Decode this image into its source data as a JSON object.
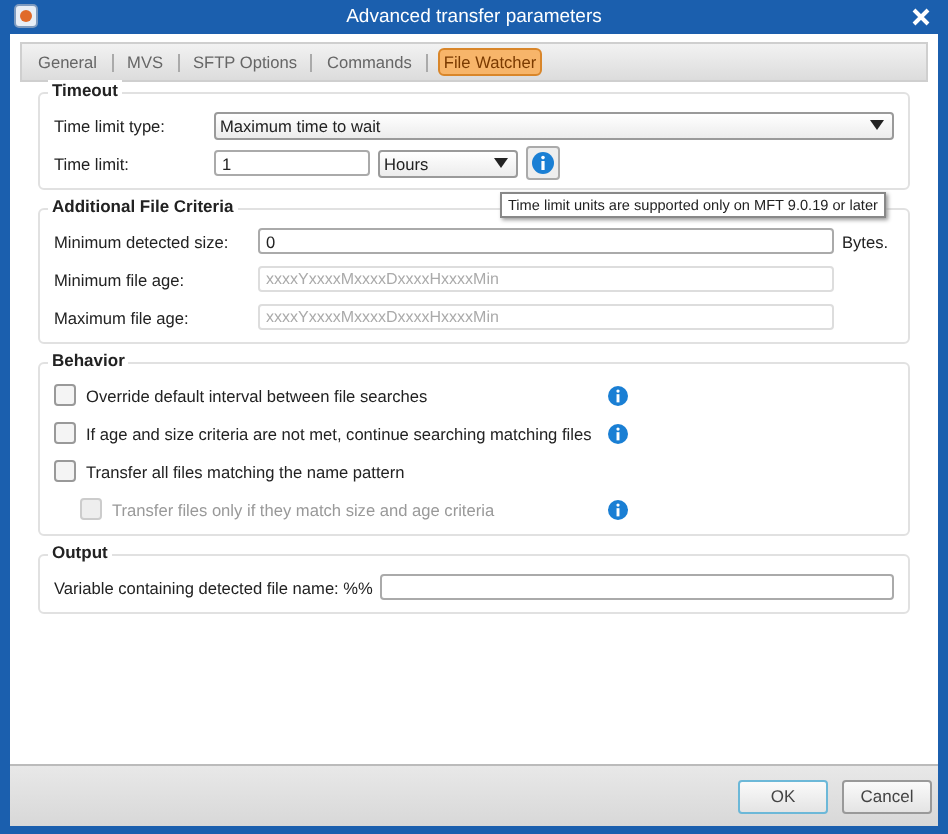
{
  "window": {
    "title": "Advanced transfer parameters"
  },
  "tabs": [
    {
      "label": "General",
      "selected": false
    },
    {
      "label": "MVS",
      "selected": false
    },
    {
      "label": "SFTP Options",
      "selected": false
    },
    {
      "label": "Commands",
      "selected": false
    },
    {
      "label": "File Watcher",
      "selected": true
    }
  ],
  "timeout": {
    "title": "Timeout",
    "type_label": "Time limit type:",
    "type_value": "Maximum time to wait",
    "limit_label": "Time limit:",
    "limit_value": "1",
    "unit_value": "Hours"
  },
  "tooltip": "Time limit units are supported only on MFT 9.0.19 or later",
  "criteria": {
    "title": "Additional File Criteria",
    "min_size_label": "Minimum detected size:",
    "min_size_value": "0",
    "min_size_unit": "Bytes.",
    "min_age_label": "Minimum file age:",
    "min_age_placeholder": "xxxxYxxxxMxxxxDxxxxHxxxxMin",
    "max_age_label": "Maximum file age:",
    "max_age_placeholder": "xxxxYxxxxMxxxxDxxxxHxxxxMin"
  },
  "behavior": {
    "title": "Behavior",
    "options": [
      {
        "label": "Override default interval between file searches",
        "checked": false,
        "disabled": false,
        "info": true
      },
      {
        "label": "If age and size criteria are not met, continue searching matching files",
        "checked": false,
        "disabled": false,
        "info": true
      },
      {
        "label": "Transfer all files matching the name pattern",
        "checked": false,
        "disabled": false,
        "info": false,
        "children": [
          {
            "label": "Transfer files only if they match size and age criteria",
            "checked": false,
            "disabled": true,
            "info": true
          }
        ]
      }
    ]
  },
  "output": {
    "title": "Output",
    "label": "Variable containing detected file name: %%"
  },
  "buttons": [
    {
      "label": "OK",
      "default": true
    },
    {
      "label": "Cancel",
      "default": false
    }
  ]
}
